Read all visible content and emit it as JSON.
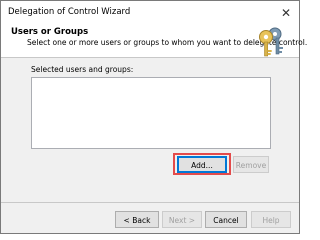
{
  "window": {
    "title": "Delegation of Control Wizard",
    "close_glyph": "✕"
  },
  "header": {
    "title": "Users or Groups",
    "description": "Select one or more users or groups to whom you want to delegate control.",
    "icon": "keys-wizard-icon"
  },
  "main": {
    "list_label": "Selected users and groups:",
    "list_items": [],
    "add_label": "Add...",
    "remove_label": "Remove"
  },
  "footer": {
    "back_label": "< Back",
    "next_label": "Next >",
    "cancel_label": "Cancel",
    "help_label": "Help"
  },
  "colors": {
    "highlight": "#e34b4b",
    "focus": "#0078d7"
  }
}
